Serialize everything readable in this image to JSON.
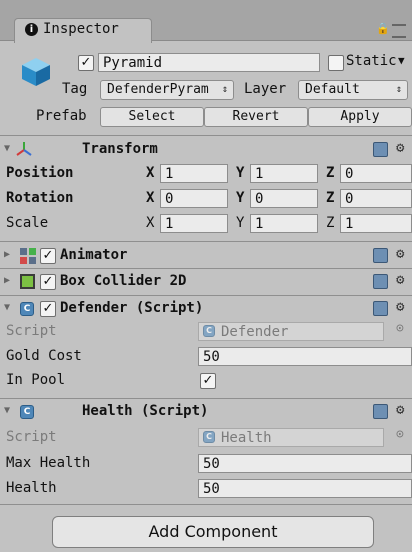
{
  "tab": {
    "label": "Inspector"
  },
  "object": {
    "name": "Pyramid",
    "static_label": "Static",
    "active": true,
    "tag_label": "Tag",
    "tag_value": "DefenderPyram",
    "layer_label": "Layer",
    "layer_value": "Default",
    "prefab_label": "Prefab",
    "prefab_buttons": [
      "Select",
      "Revert",
      "Apply"
    ]
  },
  "transform": {
    "title": "Transform",
    "rows": [
      {
        "label": "Position",
        "x": "1",
        "y": "1",
        "z": "0"
      },
      {
        "label": "Rotation",
        "x": "0",
        "y": "0",
        "z": "0"
      },
      {
        "label": "Scale",
        "x": "1",
        "y": "1",
        "z": "1"
      }
    ],
    "axis": [
      "X",
      "Y",
      "Z"
    ]
  },
  "components": {
    "animator": {
      "title": "Animator"
    },
    "collider": {
      "title": "Box Collider 2D"
    },
    "defender": {
      "title": "Defender (Script)",
      "script_label": "Script",
      "script_value": "Defender",
      "gold_label": "Gold Cost",
      "gold_value": "50",
      "pool_label": "In Pool",
      "pool_checked": true
    },
    "health": {
      "title": "Health (Script)",
      "script_label": "Script",
      "script_value": "Health",
      "max_label": "Max Health",
      "max_value": "50",
      "health_label": "Health",
      "health_value": "50"
    }
  },
  "add_component": "Add Component",
  "colors": {
    "panel": "#c2c2c2",
    "tabbar": "#a5a5a5",
    "field": "#ebebeb",
    "script_icon": "#4f87b8"
  }
}
